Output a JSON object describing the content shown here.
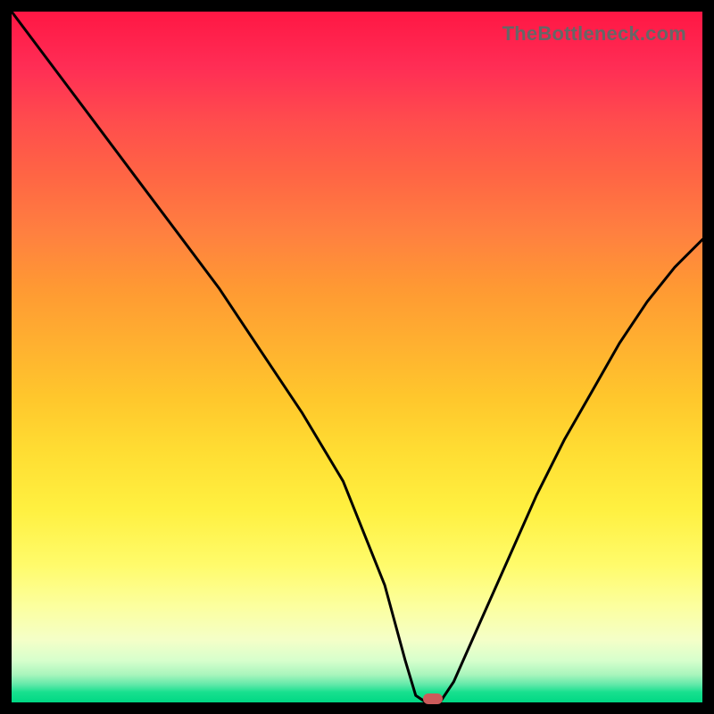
{
  "watermark": "TheBottleneck.com",
  "colors": {
    "background": "#000000",
    "curve_stroke": "#000000",
    "marker_fill": "#cc5a5a"
  },
  "chart_data": {
    "type": "line",
    "title": "",
    "xlabel": "",
    "ylabel": "",
    "xlim": [
      0,
      100
    ],
    "ylim": [
      0,
      100
    ],
    "grid": false,
    "legend": false,
    "series": [
      {
        "name": "bottleneck-curve",
        "x": [
          0,
          6,
          12,
          18,
          24,
          30,
          36,
          42,
          48,
          54,
          57,
          58.5,
          60,
          62,
          64,
          68,
          72,
          76,
          80,
          84,
          88,
          92,
          96,
          100
        ],
        "values": [
          100,
          92,
          84,
          76,
          68,
          60,
          51,
          42,
          32,
          17,
          6,
          1,
          0,
          0,
          3,
          12,
          21,
          30,
          38,
          45,
          52,
          58,
          63,
          67
        ]
      }
    ],
    "marker": {
      "x": 61,
      "y": 0.5
    },
    "gradient_stops": [
      {
        "pos": 0,
        "color": "#ff1744"
      },
      {
        "pos": 8,
        "color": "#ff2d55"
      },
      {
        "pos": 16,
        "color": "#ff4d4d"
      },
      {
        "pos": 24,
        "color": "#ff6644"
      },
      {
        "pos": 32,
        "color": "#ff8040"
      },
      {
        "pos": 40,
        "color": "#ff9933"
      },
      {
        "pos": 48,
        "color": "#ffb030"
      },
      {
        "pos": 56,
        "color": "#ffc72c"
      },
      {
        "pos": 64,
        "color": "#ffde33"
      },
      {
        "pos": 72,
        "color": "#fff040"
      },
      {
        "pos": 80,
        "color": "#fffb6a"
      },
      {
        "pos": 86,
        "color": "#fcff9e"
      },
      {
        "pos": 91,
        "color": "#f4ffc8"
      },
      {
        "pos": 94,
        "color": "#d6ffcc"
      },
      {
        "pos": 96,
        "color": "#a8f5bc"
      },
      {
        "pos": 97.5,
        "color": "#5de8a8"
      },
      {
        "pos": 98.5,
        "color": "#18e08f"
      },
      {
        "pos": 100,
        "color": "#00d884"
      }
    ]
  }
}
